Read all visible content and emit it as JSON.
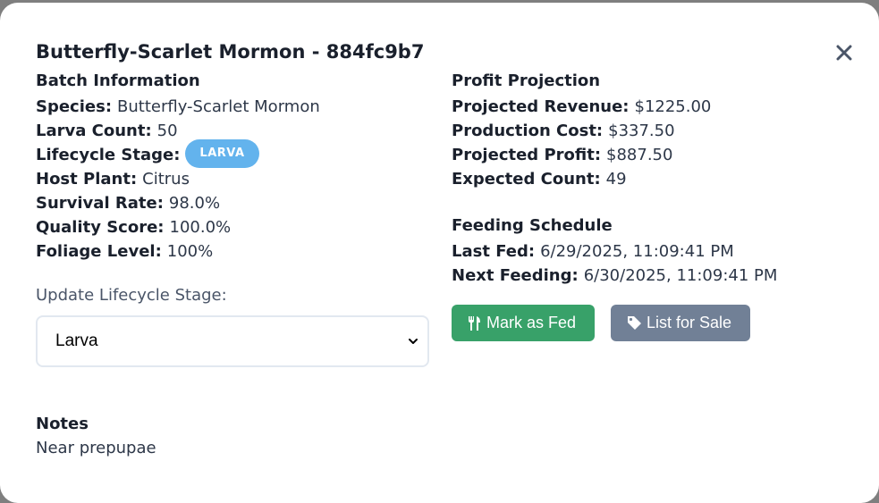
{
  "modal": {
    "title": "Butterfly-Scarlet Mormon - 884fc9b7",
    "close_icon": "close-icon"
  },
  "batch_info": {
    "heading": "Batch Information",
    "species_label": "Species:",
    "species_value": "Butterfly-Scarlet Mormon",
    "larva_count_label": "Larva Count:",
    "larva_count_value": "50",
    "lifecycle_label": "Lifecycle Stage:",
    "lifecycle_badge": "LARVA",
    "host_plant_label": "Host Plant:",
    "host_plant_value": "Citrus",
    "survival_label": "Survival Rate:",
    "survival_value": "98.0%",
    "quality_label": "Quality Score:",
    "quality_value": "100.0%",
    "foliage_label": "Foliage Level:",
    "foliage_value": "100%"
  },
  "update_stage": {
    "label": "Update Lifecycle Stage:",
    "selected": "Larva"
  },
  "notes": {
    "heading": "Notes",
    "text": "Near prepupae"
  },
  "profit": {
    "heading": "Profit Projection",
    "revenue_label": "Projected Revenue:",
    "revenue_value": "$1225.00",
    "cost_label": "Production Cost:",
    "cost_value": "$337.50",
    "profit_label": "Projected Profit:",
    "profit_value": "$887.50",
    "expected_label": "Expected Count:",
    "expected_value": "49"
  },
  "feeding": {
    "heading": "Feeding Schedule",
    "last_fed_label": "Last Fed:",
    "last_fed_value": "6/29/2025, 11:09:41 PM",
    "next_feeding_label": "Next Feeding:",
    "next_feeding_value": "6/30/2025, 11:09:41 PM"
  },
  "actions": {
    "mark_fed_label": "Mark as Fed",
    "mark_fed_icon": "utensils-icon",
    "list_sale_label": "List for Sale",
    "list_sale_icon": "tag-icon"
  },
  "colors": {
    "badge": "#63b3ed",
    "mark_fed_button": "#38a169",
    "list_sale_button": "#718096"
  }
}
